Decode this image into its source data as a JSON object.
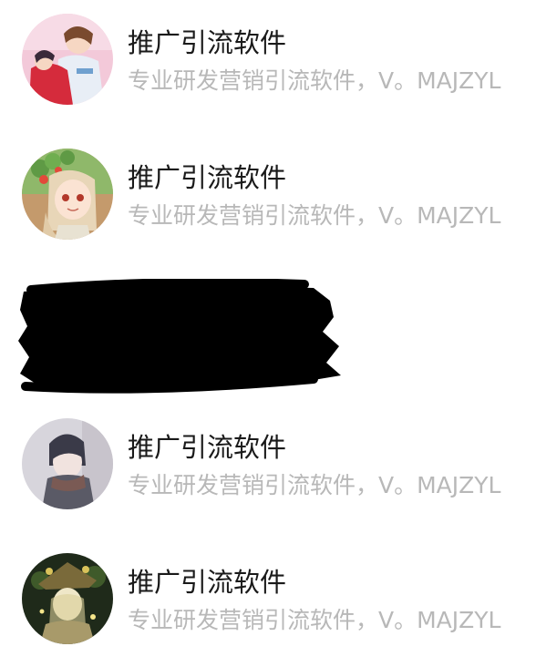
{
  "contacts": [
    {
      "name": "推广引流软件",
      "desc": "专业研发营销引流软件，V。MAJZYL",
      "avatar": "avatar-anime-couple"
    },
    {
      "name": "推广引流软件",
      "desc": "专业研发营销引流软件，V。MAJZYL",
      "avatar": "avatar-anime-girl-flowers"
    },
    {
      "name": "推广引流软件",
      "desc": "专业研发营销引流软件，V。MAJZYL",
      "avatar": "avatar-anime-boy-scarf"
    },
    {
      "name": "推广引流软件",
      "desc": "专业研发营销引流软件，V。MAJZYL",
      "avatar": "avatar-anime-girl-hat"
    }
  ],
  "colors": {
    "name_text": "#1a1a1a",
    "desc_text": "#b8b8b8",
    "background": "#ffffff",
    "redaction": "#000000"
  }
}
